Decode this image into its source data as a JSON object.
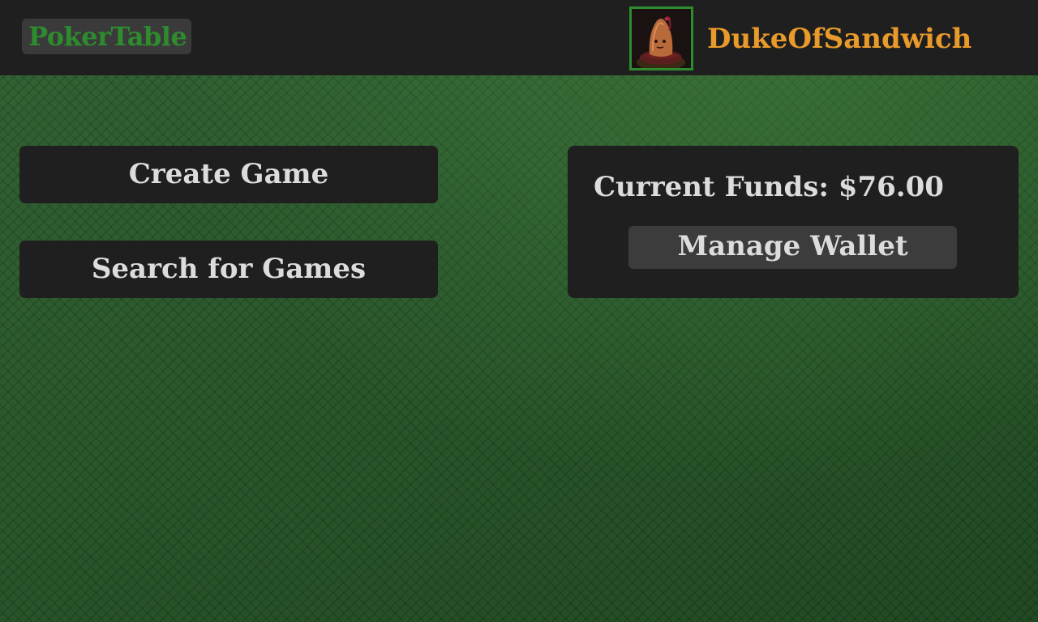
{
  "header": {
    "app_name": "PokerTable",
    "username": "DukeOfSandwich",
    "avatar_icon": "profile-avatar-icon"
  },
  "actions": {
    "create_game_label": "Create Game",
    "search_games_label": "Search for Games"
  },
  "wallet": {
    "funds_label": "Current Funds:",
    "funds_value": "$76.00",
    "manage_label": "Manage Wallet"
  },
  "colors": {
    "background_felt": "#2a5e2c",
    "panel": "#1f1f1f",
    "brand_green": "#2e8b2e",
    "username_orange": "#e89a2a",
    "button_text": "#dcdcdc"
  }
}
